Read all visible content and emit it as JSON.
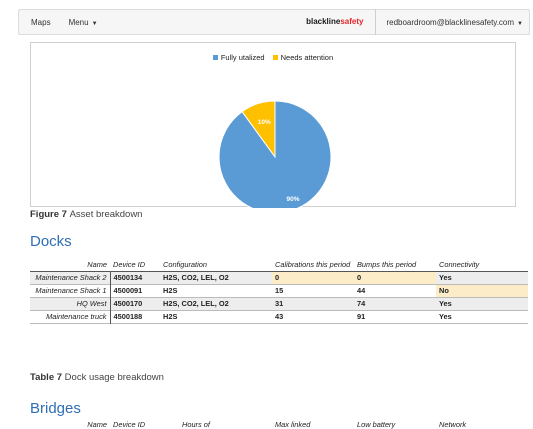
{
  "nav": {
    "maps_label": "Maps",
    "menu_label": "Menu",
    "brand_left": "blackline",
    "brand_right": "safety",
    "user_email": "redboardroom@blacklinesafety.com"
  },
  "chart_data": {
    "type": "pie",
    "title": "",
    "legend": [
      {
        "name": "Fully utalized",
        "color": "#5b9bd5"
      },
      {
        "name": "Needs attention",
        "color": "#ffc000"
      }
    ],
    "slices": [
      {
        "name": "Fully utalized",
        "value": 90,
        "label": "90%",
        "color": "#5b9bd5"
      },
      {
        "name": "Needs attention",
        "value": 10,
        "label": "10%",
        "color": "#ffc000"
      }
    ],
    "legend_position": "top-center"
  },
  "figure_caption": {
    "label": "Figure 7",
    "text": "Asset breakdown"
  },
  "docks": {
    "heading": "Docks",
    "columns": [
      "Name",
      "Device ID",
      "Configuration",
      "Calibrations this period",
      "Bumps this period",
      "Connectivity"
    ],
    "rows": [
      {
        "name": "Maintenance Shack 2",
        "device_id": "4500134",
        "config": "H2S, CO2, LEL, O2",
        "calibrations": "0",
        "bumps": "0",
        "connectivity": "Yes"
      },
      {
        "name": "Maintenance Shack 1",
        "device_id": "4500091",
        "config": "H2S",
        "calibrations": "15",
        "bumps": "44",
        "connectivity": "No"
      },
      {
        "name": "HQ West",
        "device_id": "4500170",
        "config": "H2S, CO2, LEL, O2",
        "calibrations": "31",
        "bumps": "74",
        "connectivity": "Yes"
      },
      {
        "name": "Maintenance truck",
        "device_id": "4500188",
        "config": "H2S",
        "calibrations": "43",
        "bumps": "91",
        "connectivity": "Yes"
      }
    ]
  },
  "table_caption": {
    "label": "Table 7",
    "text": "Dock usage breakdown"
  },
  "bridges": {
    "heading": "Bridges",
    "columns": [
      "Name",
      "Device ID",
      "Hours of",
      "Max linked",
      "Low battery",
      "Network"
    ]
  }
}
